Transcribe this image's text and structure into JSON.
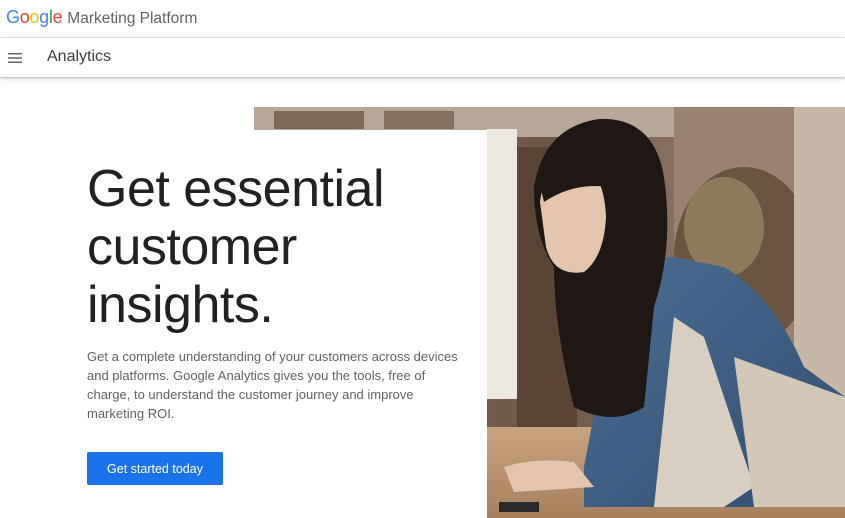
{
  "header": {
    "logo_letters": [
      {
        "char": "G",
        "color": "#4285F4"
      },
      {
        "char": "o",
        "color": "#EA4335"
      },
      {
        "char": "o",
        "color": "#FBBC05"
      },
      {
        "char": "g",
        "color": "#4285F4"
      },
      {
        "char": "l",
        "color": "#34A853"
      },
      {
        "char": "e",
        "color": "#EA4335"
      }
    ],
    "logo_text": "Google",
    "product": "Marketing Platform"
  },
  "nav": {
    "menu_icon": "hamburger-menu-icon",
    "title": "Analytics"
  },
  "hero": {
    "title_lines": [
      "Get essential",
      "customer",
      "insights."
    ],
    "description": "Get a complete understanding of your customers across devices and platforms. Google Analytics gives you the tools, free of charge, to understand the customer journey and improve marketing ROI.",
    "cta_label": "Get started today",
    "cta_color": "#1a73e8",
    "image_subject": "woman-working-at-laptop-photo"
  }
}
